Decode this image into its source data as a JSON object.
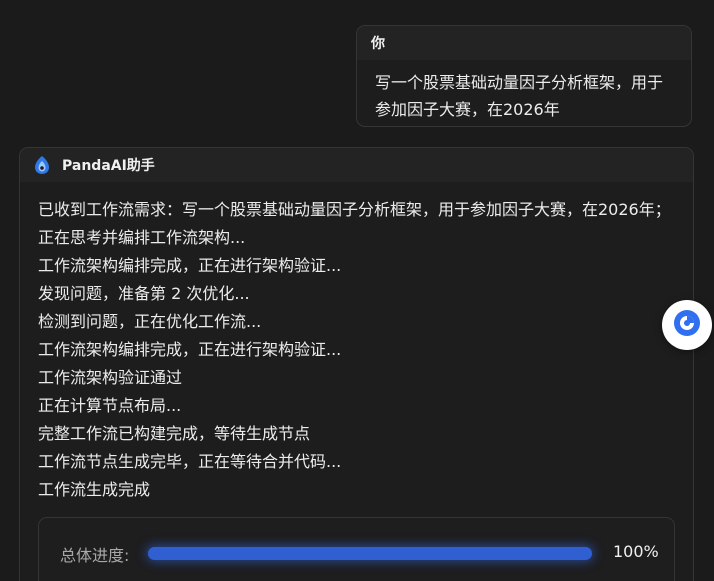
{
  "user_message": {
    "sender": "你",
    "text": "写一个股票基础动量因子分析框架，用于参加因子大赛，在2026年"
  },
  "assistant_message": {
    "sender": "PandaAI助手",
    "logo_icon": "panda-ai-logo-icon",
    "lines": [
      "已收到工作流需求：写一个股票基础动量因子分析框架，用于参加因子大赛，在2026年；正在思考并编排工作流架构...",
      "工作流架构编排完成，正在进行架构验证...",
      "发现问题，准备第 2 次优化...",
      "检测到问题，正在优化工作流...",
      "工作流架构编排完成，正在进行架构验证...",
      "工作流架构验证通过",
      "正在计算节点布局...",
      "完整工作流已构建完成，等待生成节点",
      "工作流节点生成完毕，正在等待合并代码...",
      "工作流生成完成"
    ],
    "progress": {
      "label": "总体进度:",
      "value_text": "100%",
      "fraction": 1.0
    }
  },
  "floating_button": {
    "icon": "assistant-chat-icon"
  },
  "colors": {
    "background": "#1b1b1c",
    "card_border": "#353537",
    "progress_fill": "#2f5fd0",
    "float_icon": "#2f6ff0"
  }
}
